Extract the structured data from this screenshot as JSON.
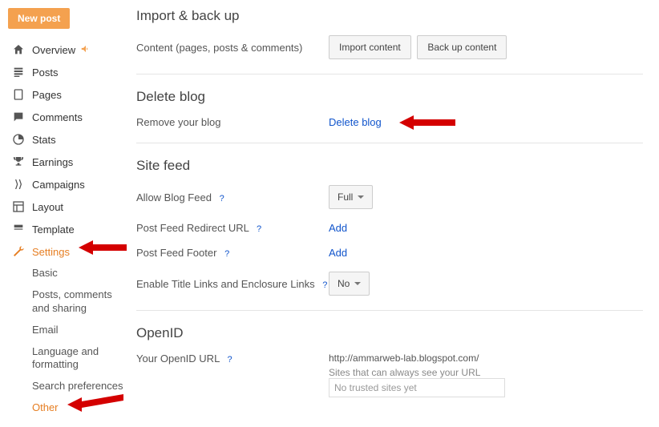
{
  "sidebar": {
    "new_post": "New post",
    "items": [
      {
        "label": "Overview"
      },
      {
        "label": "Posts"
      },
      {
        "label": "Pages"
      },
      {
        "label": "Comments"
      },
      {
        "label": "Stats"
      },
      {
        "label": "Earnings"
      },
      {
        "label": "Campaigns"
      },
      {
        "label": "Layout"
      },
      {
        "label": "Template"
      },
      {
        "label": "Settings"
      }
    ],
    "settings_sub": [
      {
        "label": "Basic"
      },
      {
        "label": "Posts, comments and sharing"
      },
      {
        "label": "Email"
      },
      {
        "label": "Language and formatting"
      },
      {
        "label": "Search preferences"
      },
      {
        "label": "Other"
      }
    ]
  },
  "sections": {
    "import": {
      "title": "Import & back up",
      "desc": "Content (pages, posts & comments)",
      "btn_import": "Import content",
      "btn_backup": "Back up content"
    },
    "delete": {
      "title": "Delete blog",
      "desc": "Remove your blog",
      "link": "Delete blog"
    },
    "sitefeed": {
      "title": "Site feed",
      "allow_label": "Allow Blog Feed",
      "allow_value": "Full",
      "redirect_label": "Post Feed Redirect URL",
      "redirect_link": "Add",
      "footer_label": "Post Feed Footer",
      "footer_link": "Add",
      "enable_label": "Enable Title Links and Enclosure Links",
      "enable_value": "No"
    },
    "openid": {
      "title": "OpenID",
      "url_label": "Your OpenID URL",
      "url_value": "http://ammarweb-lab.blogspot.com/",
      "trusted_label": "Sites that can always see your URL",
      "trusted_placeholder": "No trusted sites yet"
    }
  },
  "help": "?"
}
